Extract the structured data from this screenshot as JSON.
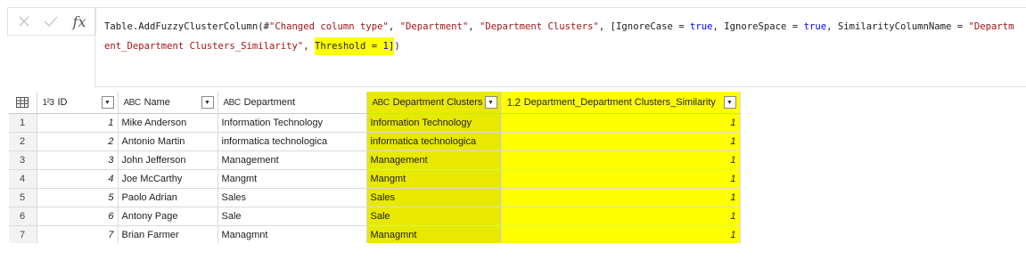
{
  "formula": {
    "cancel_icon": "close-icon",
    "commit_icon": "check-icon",
    "fx_label": "fx",
    "seg1": "Table.AddFuzzyClusterColumn(#",
    "seg2": "\"Changed column type\"",
    "seg3": ", ",
    "seg4": "\"Department\"",
    "seg5": ", ",
    "seg6": "\"Department Clusters\"",
    "seg7": ", [IgnoreCase = ",
    "seg8": "true",
    "seg9": ", IgnoreSpace = ",
    "seg10": "true",
    "seg11": ", SimilarityColumnName = ",
    "seg12": "\"Department_Department Clusters_Similarity\"",
    "seg13": ", ",
    "seg14_hl": "Threshold = ",
    "seg15_hl": "1]",
    "seg16": ")",
    "highlight_color": "#ffff00"
  },
  "grid": {
    "columns": [
      {
        "type": "1²3",
        "label": "ID"
      },
      {
        "type": "ABC",
        "label": "Name"
      },
      {
        "type": "ABC",
        "label": "Department"
      },
      {
        "type": "ABC",
        "label": "Department Clusters"
      },
      {
        "type": "1.2",
        "label": "Department_Department Clusters_Similarity"
      }
    ],
    "rows": [
      {
        "n": "1",
        "id": "1",
        "name": "Mike Anderson",
        "dept": "Information Technology",
        "cluster": "Information Technology",
        "sim": "1"
      },
      {
        "n": "2",
        "id": "2",
        "name": "Antonio Martin",
        "dept": "informatica technologica",
        "cluster": "informatica technologica",
        "sim": "1"
      },
      {
        "n": "3",
        "id": "3",
        "name": "John Jefferson",
        "dept": "Management",
        "cluster": "Management",
        "sim": "1"
      },
      {
        "n": "4",
        "id": "4",
        "name": "Joe McCarthy",
        "dept": "Mangmt",
        "cluster": "Mangmt",
        "sim": "1"
      },
      {
        "n": "5",
        "id": "5",
        "name": "Paolo Adrian",
        "dept": "Sales",
        "cluster": "Sales",
        "sim": "1"
      },
      {
        "n": "6",
        "id": "6",
        "name": "Antony Page",
        "dept": "Sale",
        "cluster": "Sale",
        "sim": "1"
      },
      {
        "n": "7",
        "id": "7",
        "name": "Brian Farmer",
        "dept": "Managmnt",
        "cluster": "Managmnt",
        "sim": "1"
      }
    ],
    "highlight_colors": {
      "cluster_column": "#e8e800",
      "similarity_column": "#ffff00"
    }
  }
}
